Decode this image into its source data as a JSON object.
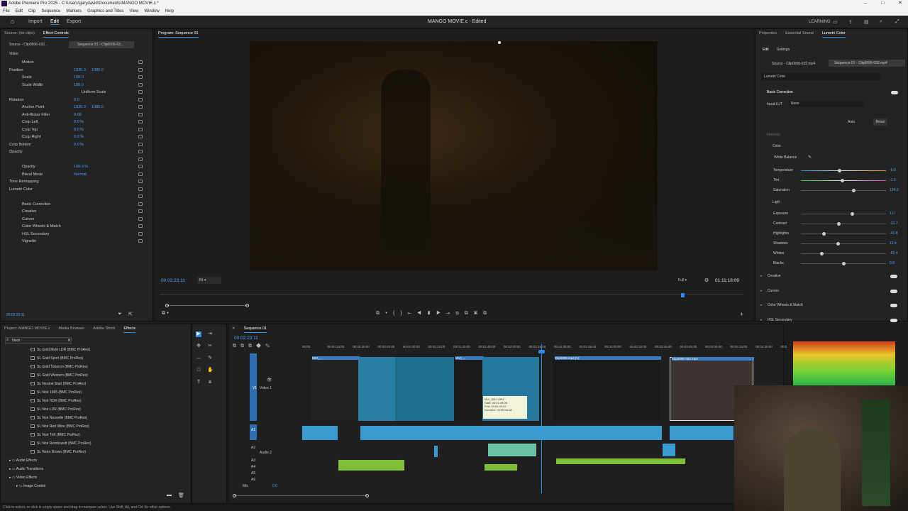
{
  "window": {
    "title": "Adobe Premiere Pro 2025 - C:\\Users\\garydavid\\Documents\\MANGO MOVIE.c *"
  },
  "menu": [
    "File",
    "Edit",
    "Clip",
    "Sequence",
    "Markers",
    "Graphics and Titles",
    "View",
    "Window",
    "Help"
  ],
  "appbar": {
    "home": "⌂",
    "import": "Import",
    "edit": "Edit",
    "export": "Export",
    "project_title": "MANGO MOVIE.c - Edited",
    "learning": "LEARNING"
  },
  "source_panel": {
    "tab1": "Source: (no clips)",
    "tab2": "Effect Controls",
    "clip_a": "Source - Clip0006-032...",
    "clip_b": "Sequence 01 - Clip0006-03...",
    "section_video": "Video"
  },
  "effect_rows": [
    {
      "label": "Motion",
      "val": "",
      "val2": ""
    },
    {
      "label": "Position",
      "val": "1920.0",
      "val2": "1080.0"
    },
    {
      "label": "Scale",
      "val": "100.0",
      "val2": ""
    },
    {
      "label": "Scale Width",
      "val": "100.0",
      "val2": ""
    },
    {
      "label": "Uniform Scale",
      "val": "",
      "val2": ""
    },
    {
      "label": "Rotation",
      "val": "0.0",
      "val2": ""
    },
    {
      "label": "Anchor Point",
      "val": "1920.0",
      "val2": "1080.0"
    },
    {
      "label": "Anti-flicker Filter",
      "val": "0.00",
      "val2": ""
    },
    {
      "label": "Crop Left",
      "val": "0.0 %",
      "val2": ""
    },
    {
      "label": "Crop Top",
      "val": "0.0 %",
      "val2": ""
    },
    {
      "label": "Crop Right",
      "val": "0.0 %",
      "val2": ""
    },
    {
      "label": "Crop Bottom",
      "val": "0.0 %",
      "val2": ""
    },
    {
      "label": "Opacity",
      "val": "",
      "val2": ""
    },
    {
      "label": "",
      "val": "",
      "val2": ""
    },
    {
      "label": "Opacity",
      "val": "100.0 %",
      "val2": ""
    },
    {
      "label": "Blend Mode",
      "val": "Normal",
      "val2": ""
    },
    {
      "label": "Time Remapping",
      "val": "",
      "val2": ""
    },
    {
      "label": "Lumetri Color",
      "val": "",
      "val2": ""
    },
    {
      "label": "",
      "val": "",
      "val2": ""
    },
    {
      "label": "Basic Correction",
      "val": "",
      "val2": ""
    },
    {
      "label": "Creative",
      "val": "",
      "val2": ""
    },
    {
      "label": "Curves",
      "val": "",
      "val2": ""
    },
    {
      "label": "Color Wheels & Match",
      "val": "",
      "val2": ""
    },
    {
      "label": "HSL Secondary",
      "val": "",
      "val2": ""
    },
    {
      "label": "Vignette",
      "val": "",
      "val2": ""
    }
  ],
  "source_time": "00:02:23:11",
  "program": {
    "title": "Program: Sequence 01",
    "timecode": "00:02:23:11",
    "fit": "Fit",
    "full": "Full",
    "duration": "01:11:18:09"
  },
  "project": {
    "tabs": [
      "Project: MANGO MOVIE.c",
      "Media Browser",
      "Adobe Stock",
      "Effects"
    ],
    "search": "black",
    "effects": [
      "SL Gold Multi LDR (BMC ProRes)",
      "SL Gold Sport (BMC ProRes)",
      "SL Gold Tobacco (BMC ProRes)",
      "SL Gold Western (BMC ProRes)",
      "SL Neutral Start (BMC ProRes)",
      "SL Noir 1965 (BMC ProRes)",
      "SL Noir HDR (BMC ProRes)",
      "SL Noir LDR (BMC ProRes)",
      "SL Noir Nouvelle (BMC ProRes)",
      "SL Noir Red Wine (BMC ProRes)",
      "SL Noir TriX (BMC ProRes)",
      "SL Noir Rembrandt (BMC ProRes)",
      "SL Retro Brown (BMC ProRes)"
    ],
    "folders": [
      "Audio Effects",
      "Audio Transitions",
      "Video Effects",
      "Image Control"
    ]
  },
  "timeline": {
    "tab": "Sequence 01",
    "timecode": "00:02:23:11",
    "ruler": [
      "00:00",
      "00:00:15:00",
      "00:00:30:00",
      "00:00:45:00",
      "00:01:00:00",
      "00:01:15:00",
      "00:01:30:00",
      "00:01:45:00",
      "00:02:00:00",
      "00:02:15:00",
      "00:02:30:00",
      "00:02:45:00",
      "00:03:00:00",
      "00:03:15:00",
      "00:03:30:00",
      "00:03:45:00",
      "00:04:00:00",
      "00:04:15:00",
      "00:04:30:00",
      "00:0"
    ],
    "tracks": [
      "V1",
      "Video 1",
      "A1",
      "A2",
      "Audio 2",
      "A3",
      "A4",
      "A5",
      "A6",
      "Mix"
    ],
    "mix_val": "0.0",
    "clip_labels": [
      "MVI_...",
      "MVI_...",
      "Clip0005.mp4 [V]",
      "Clip0006-032.mp4"
    ],
    "tooltip": {
      "name": "MVI_0017.MP4",
      "start": "Start: 00:01:49:05",
      "end": "End: 00:01:49:22",
      "dur": "Duration: 00:00:00:18"
    }
  },
  "right_panel": {
    "tabs": [
      "Properties",
      "Essential Sound",
      "Lumetri Color"
    ],
    "sub": [
      "Edit",
      "Settings"
    ],
    "src_a": "Source - Clip0006-032.mp4",
    "src_b": "Sequence 01 - Clip0006-032.mp4",
    "fx": "Lumetri Color",
    "basic": "Basic Correction",
    "input_lut": "Input LUT",
    "lut_val": "None",
    "auto": "Auto",
    "reset": "Reset",
    "intensity": "Intensity",
    "color": "Color",
    "wb": "White Balance",
    "sliders": [
      {
        "label": "Temperature",
        "val": "-9.0",
        "pos": 0.45
      },
      {
        "label": "Tint",
        "val": "-1.9",
        "pos": 0.48
      },
      {
        "label": "Saturation",
        "val": "124.0",
        "pos": 0.62
      }
    ],
    "light": "Light",
    "light_sliders": [
      {
        "label": "Exposure",
        "val": "1.0",
        "pos": 0.6
      },
      {
        "label": "Contrast",
        "val": "-10.7",
        "pos": 0.44
      },
      {
        "label": "Highlights",
        "val": "-41.8",
        "pos": 0.27
      },
      {
        "label": "Shadows",
        "val": "12.4",
        "pos": 0.43
      },
      {
        "label": "Whites",
        "val": "-50.4",
        "pos": 0.24
      },
      {
        "label": "Blacks",
        "val": "0.8",
        "pos": 0.5
      }
    ],
    "sections": [
      "Creative",
      "Curves",
      "Color Wheels & Match",
      "HSL Secondary"
    ]
  },
  "status": "Click to select, or click in empty space and drag to marquee select. Use Shift, Alt, and Ctrl for other options."
}
